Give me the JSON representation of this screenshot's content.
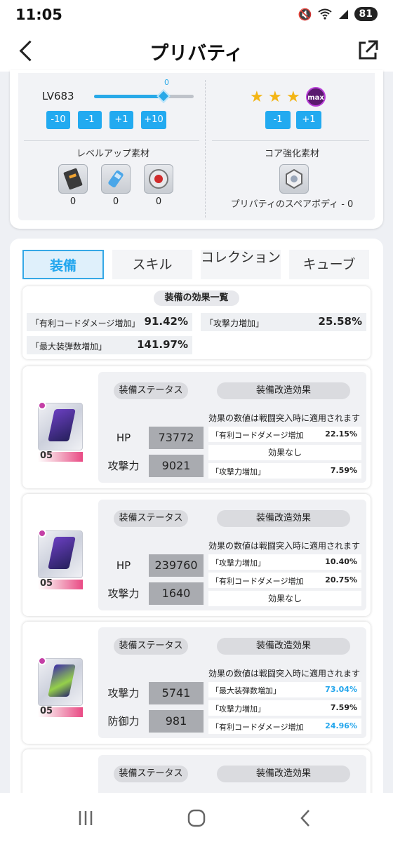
{
  "status_bar": {
    "time": "11:05",
    "battery": "81"
  },
  "app_bar": {
    "title": "プリバティ"
  },
  "level": {
    "label": "LV683",
    "slider_value": "0",
    "slider_fraction": 0.7,
    "buttons": [
      "-10",
      "-1",
      "+1",
      "+10"
    ],
    "materials_title": "レベルアップ素材",
    "materials": [
      {
        "icon": "ticket-icon",
        "count": "0"
      },
      {
        "icon": "battery-icon",
        "count": "0"
      },
      {
        "icon": "core-orb-icon",
        "count": "0"
      }
    ]
  },
  "core": {
    "stars_filled": 3,
    "max_label": "max",
    "buttons": [
      "-1",
      "+1"
    ],
    "materials_title": "コア強化素材",
    "spare_body_label": "プリバティのスペアボディ - 0"
  },
  "tabs": [
    {
      "label": "装備",
      "active": true
    },
    {
      "label": "スキル",
      "active": false
    },
    {
      "label": "コレクション",
      "active": false
    },
    {
      "label": "キューブ",
      "active": false
    }
  ],
  "summary": {
    "title": "装備の効果一覧",
    "items": [
      {
        "label": "「有利コードダメージ増加」",
        "value": "91.42%"
      },
      {
        "label": "「攻撃力増加」",
        "value": "25.58%"
      },
      {
        "label": "「最大装弾数増加」",
        "value": "141.97%"
      }
    ]
  },
  "equipment": {
    "status_label": "装備ステータス",
    "mod_label": "装備改造効果",
    "note": "効果の数値は戦闘突入時に適用されます",
    "none_label": "効果なし",
    "cards": [
      {
        "level": "05",
        "stats": [
          {
            "label": "HP",
            "value": "73772"
          },
          {
            "label": "攻撃力",
            "value": "9021"
          }
        ],
        "effects": [
          {
            "type": "row",
            "label": "「有利コードダメージ増加」",
            "value": "22.15%",
            "highlight": false
          },
          {
            "type": "none"
          },
          {
            "type": "row",
            "label": "「攻撃力増加」",
            "value": "7.59%",
            "highlight": false
          }
        ]
      },
      {
        "level": "05",
        "stats": [
          {
            "label": "HP",
            "value": "239760"
          },
          {
            "label": "攻撃力",
            "value": "1640"
          }
        ],
        "effects": [
          {
            "type": "row",
            "label": "「攻撃力増加」",
            "value": "10.40%",
            "highlight": false
          },
          {
            "type": "row",
            "label": "「有利コードダメージ増加」",
            "value": "20.75%",
            "highlight": false
          },
          {
            "type": "none"
          }
        ]
      },
      {
        "level": "05",
        "stats": [
          {
            "label": "攻撃力",
            "value": "5741"
          },
          {
            "label": "防御力",
            "value": "981"
          }
        ],
        "effects": [
          {
            "type": "row",
            "label": "「最大装弾数増加」",
            "value": "73.04%",
            "highlight": true
          },
          {
            "type": "row",
            "label": "「攻撃力増加」",
            "value": "7.59%",
            "highlight": false
          },
          {
            "type": "row",
            "label": "「有利コードダメージ増加」",
            "value": "24.96%",
            "highlight": true
          }
        ]
      },
      {
        "partial": true
      }
    ]
  },
  "colors": {
    "accent": "#22aaf0",
    "highlight_text": "#24a6ec",
    "level_badge": "#e94a84",
    "star": "#f3b515"
  }
}
